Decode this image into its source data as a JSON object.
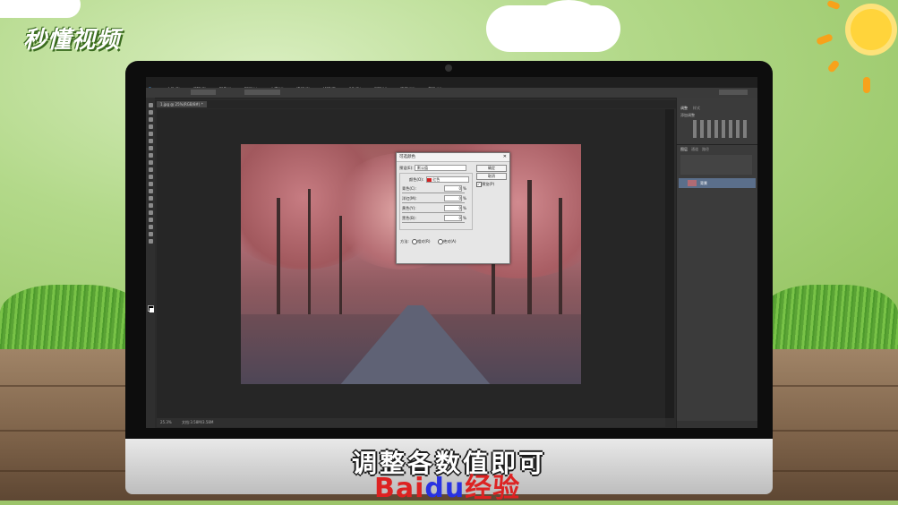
{
  "watermark": {
    "logo_text": "秒懂视频"
  },
  "subtitle": "调整各数值即可",
  "baidu": {
    "bai": "Bai",
    "du": "du",
    "jingyan": "经验"
  },
  "photoshop": {
    "app_icon": "Ps",
    "menu": [
      "文件(F)",
      "编辑(E)",
      "图像(I)",
      "图层(L)",
      "文字(Y)",
      "选择(S)",
      "滤镜(T)",
      "3D(D)",
      "视图(V)",
      "窗口(W)",
      "帮助(H)"
    ],
    "doc_tab": "1.jpg @ 25%(RGB/8#) *",
    "status_zoom": "25.3%",
    "status_doc": "文档:3.58M/3.58M",
    "dialog": {
      "title": "可选颜色",
      "preset_label": "预设(E):",
      "preset_value": "默认值",
      "colors_label": "颜色(O):",
      "colors_value": "红色",
      "sliders": [
        {
          "label": "青色(C):",
          "value": "0",
          "unit": "%"
        },
        {
          "label": "洋红(M):",
          "value": "0",
          "unit": "%"
        },
        {
          "label": "黄色(Y):",
          "value": "0",
          "unit": "%"
        },
        {
          "label": "黑色(B):",
          "value": "0",
          "unit": "%"
        }
      ],
      "method_label": "方法:",
      "method_relative": "相对(R)",
      "method_absolute": "绝对(A)",
      "ok": "确定",
      "cancel": "取消",
      "preview": "预览(P)"
    },
    "panels": {
      "adjust_tab": "调整",
      "styles_tab": "样式",
      "adjust_title": "添加调整",
      "layers_tab": "图层",
      "channels_tab": "通道",
      "paths_tab": "路径",
      "layer_name": "背景"
    }
  },
  "colors": {
    "accent_red": "#d22222",
    "baidu_blue": "#2932e1",
    "ps_dark": "#2b2b2b"
  }
}
